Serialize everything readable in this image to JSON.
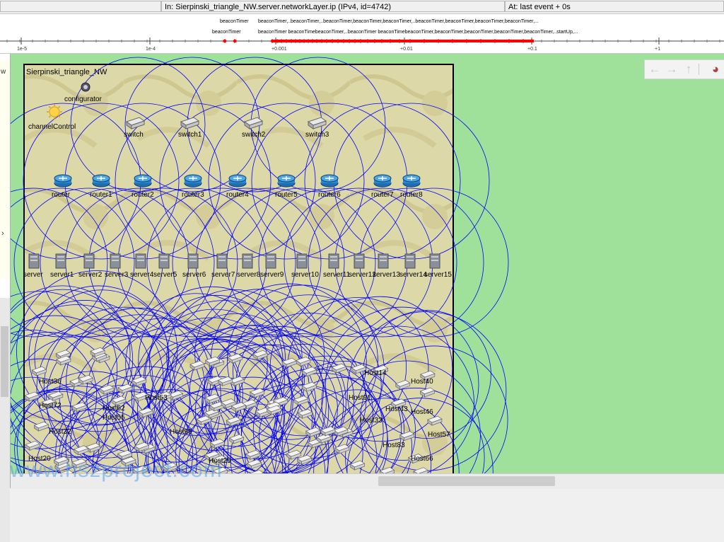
{
  "status_bar": {
    "left": "",
    "module": "In: Sierpinski_triangle_NW.server.networkLayer.ip (IPv4, id=4742)",
    "time": "At: last event + 0s"
  },
  "timeline": {
    "ticks": [
      "1e-5",
      "1e-4",
      "+0.001",
      "+0.01",
      "+0.1",
      "+1"
    ],
    "labels_row1": [
      "beaconTimer",
      "beaconTimer,..beaconTimer,..beaconTimer,beaconTimer,beaconTimer,..beaconTimer,beaconTimer,beaconTimer,beaconTimer,..."
    ],
    "labels_row2": [
      "beaconTimer",
      "beaconTimer beaconTimebeaconTimer,..beaconTimer beaconTimebeaconTimer,beaconTimer,beaconTimer,beaconTimer,beaconTimer,..startUp,..."
    ],
    "marker_color": "#ff0000"
  },
  "left_panel": {
    "label": "w"
  },
  "network": {
    "name": "Sierpinski_triangle_NW",
    "configurator": "configurator",
    "channel_control": "channelControl",
    "switches": [
      "switch",
      "switch1",
      "switch2",
      "switch3"
    ],
    "routers": [
      "router",
      "router1",
      "router2",
      "router3",
      "router4",
      "router5",
      "router6",
      "router7",
      "router8"
    ],
    "servers": [
      "server",
      "server1",
      "server2",
      "server3",
      "server4",
      "server5",
      "server6",
      "server7",
      "server8",
      "server9",
      "server10",
      "server11",
      "server12",
      "server13",
      "server14",
      "server15"
    ],
    "host_labels": [
      "Host36",
      "Host14",
      "Host40",
      "Host72",
      "Host91",
      "Host43",
      "Host46",
      "Host55",
      "Host33",
      "Host57",
      "Host32",
      "Host83",
      "Host20",
      "Host66",
      "Host99",
      "Host62",
      "Host53",
      "Host25"
    ],
    "range_color": "#0000ff",
    "background_color": "#9fe19a"
  },
  "nav_toolbar": {
    "icons": [
      "back-arrow-icon",
      "forward-arrow-icon",
      "up-arrow-icon",
      "more-icon"
    ],
    "glyphs": [
      "←",
      "→",
      "↑",
      "◕"
    ]
  },
  "watermark": "www.hszproject.com"
}
